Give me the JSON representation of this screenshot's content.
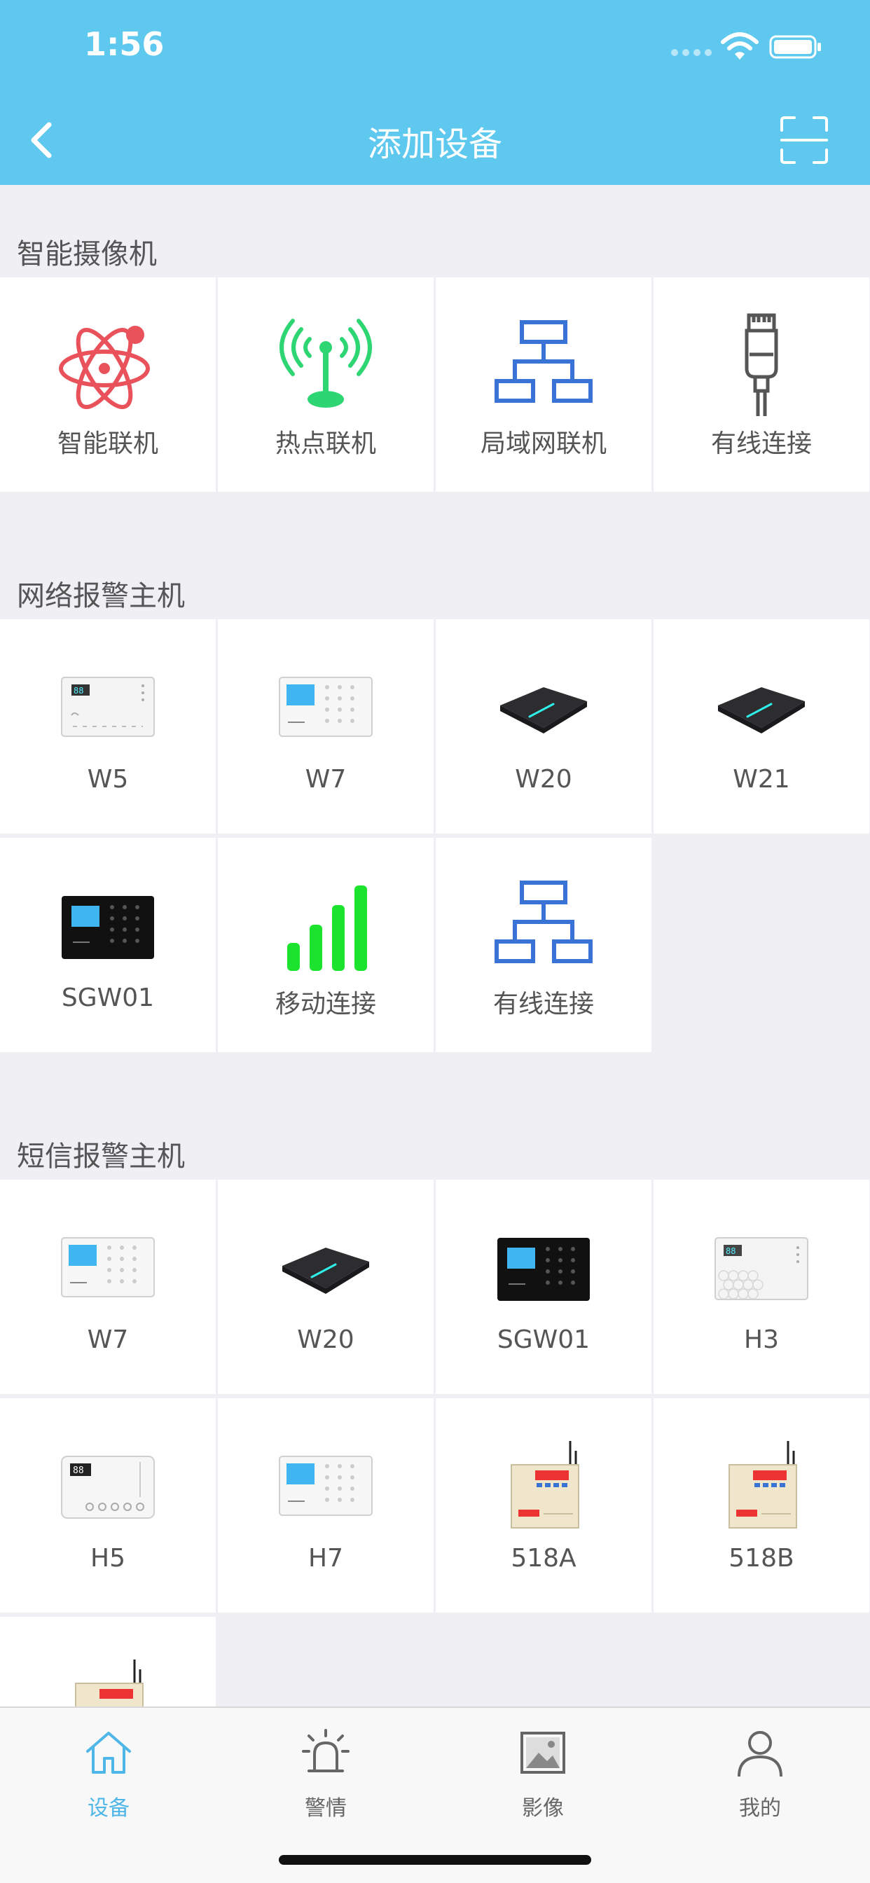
{
  "status_bar": {
    "time": "1:56"
  },
  "nav": {
    "title": "添加设备"
  },
  "sections": {
    "camera": {
      "title": "智能摄像机",
      "items": [
        {
          "label": "智能联机",
          "icon": "smart-link-icon"
        },
        {
          "label": "热点联机",
          "icon": "hotspot-icon"
        },
        {
          "label": "局域网联机",
          "icon": "lan-icon"
        },
        {
          "label": "有线连接",
          "icon": "ethernet-icon"
        }
      ]
    },
    "network": {
      "title": "网络报警主机",
      "items": [
        {
          "label": "W5"
        },
        {
          "label": "W7"
        },
        {
          "label": "W20"
        },
        {
          "label": "W21"
        },
        {
          "label": "SGW01"
        },
        {
          "label": "移动连接",
          "icon": "cellular-icon"
        },
        {
          "label": "有线连接",
          "icon": "lan-icon"
        }
      ]
    },
    "sms": {
      "title": "短信报警主机",
      "items": [
        {
          "label": "W7"
        },
        {
          "label": "W20"
        },
        {
          "label": "SGW01"
        },
        {
          "label": "H3"
        },
        {
          "label": "H5"
        },
        {
          "label": "H7"
        },
        {
          "label": "518A"
        },
        {
          "label": "518B"
        },
        {
          "label": ""
        }
      ]
    }
  },
  "tabbar": {
    "items": [
      {
        "label": "设备",
        "active": true
      },
      {
        "label": "警情",
        "active": false
      },
      {
        "label": "影像",
        "active": false
      },
      {
        "label": "我的",
        "active": false
      }
    ]
  },
  "colors": {
    "header": "#5ec8ef",
    "active_tab": "#4fb6e8",
    "green": "#22e03a",
    "blue": "#3a73d6",
    "red": "#e9525b"
  }
}
